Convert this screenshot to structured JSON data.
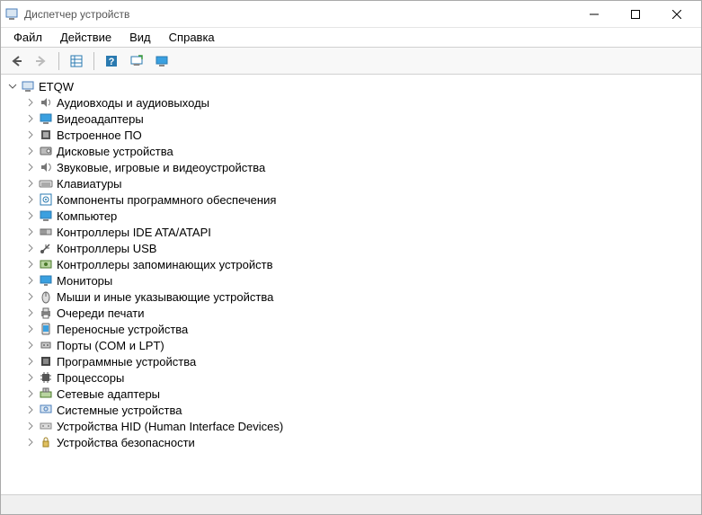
{
  "window": {
    "title": "Диспетчер устройств"
  },
  "menu": {
    "file": "Файл",
    "action": "Действие",
    "view": "Вид",
    "help": "Справка"
  },
  "tree": {
    "root": {
      "label": "ETQW",
      "expanded": true
    },
    "items": [
      {
        "label": "Аудиовходы и аудиовыходы",
        "icon": "audio-io"
      },
      {
        "label": "Видеоадаптеры",
        "icon": "display-adapter"
      },
      {
        "label": "Встроенное ПО",
        "icon": "firmware"
      },
      {
        "label": "Дисковые устройства",
        "icon": "disk"
      },
      {
        "label": "Звуковые, игровые и видеоустройства",
        "icon": "sound"
      },
      {
        "label": "Клавиатуры",
        "icon": "keyboard"
      },
      {
        "label": "Компоненты программного обеспечения",
        "icon": "software"
      },
      {
        "label": "Компьютер",
        "icon": "computer"
      },
      {
        "label": "Контроллеры IDE ATA/ATAPI",
        "icon": "ide"
      },
      {
        "label": "Контроллеры USB",
        "icon": "usb"
      },
      {
        "label": "Контроллеры запоминающих устройств",
        "icon": "storage"
      },
      {
        "label": "Мониторы",
        "icon": "monitor"
      },
      {
        "label": "Мыши и иные указывающие устройства",
        "icon": "mouse"
      },
      {
        "label": "Очереди печати",
        "icon": "printer"
      },
      {
        "label": "Переносные устройства",
        "icon": "portable"
      },
      {
        "label": "Порты (COM и LPT)",
        "icon": "port"
      },
      {
        "label": "Программные устройства",
        "icon": "softdev"
      },
      {
        "label": "Процессоры",
        "icon": "cpu"
      },
      {
        "label": "Сетевые адаптеры",
        "icon": "network"
      },
      {
        "label": "Системные устройства",
        "icon": "system"
      },
      {
        "label": "Устройства HID (Human Interface Devices)",
        "icon": "hid"
      },
      {
        "label": "Устройства безопасности",
        "icon": "security"
      }
    ]
  }
}
